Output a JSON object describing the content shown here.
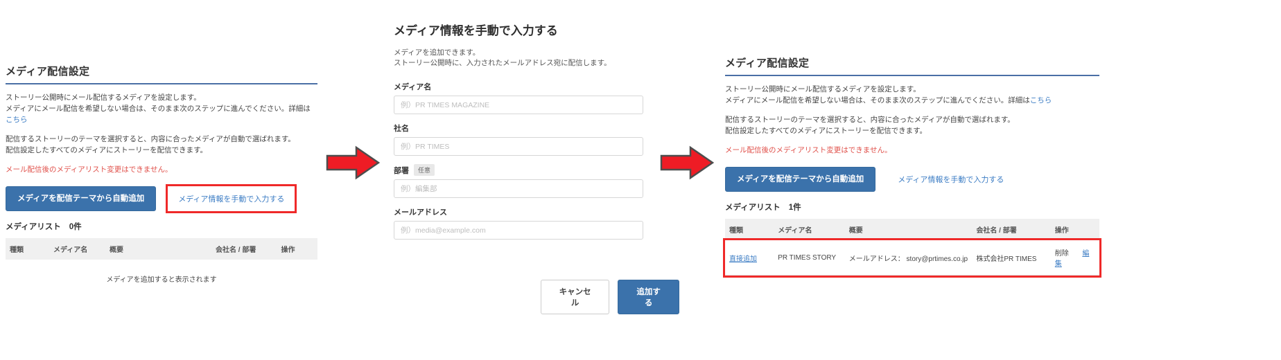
{
  "left_panel": {
    "title": "メディア配信設定",
    "desc_a1": "ストーリー公開時にメール配信するメディアを設定します。",
    "desc_a2_pre": "メディアにメール配信を希望しない場合は、そのまま次のステップに進んでください。詳細は",
    "desc_a2_link": "こちら",
    "desc_b1": "配信するストーリーのテーマを選択すると、内容に合ったメディアが自動で選ばれます。",
    "desc_b2": "配信設定したすべてのメディアにストーリーを配信できます。",
    "warning": "メール配信後のメディアリスト変更はできません。",
    "primary_button": "メディアを配信テーマから自動追加",
    "manual_link": "メディア情報を手動で入力する",
    "list_label": "メディアリスト",
    "list_count": "0件",
    "columns": [
      "種類",
      "メディア名",
      "概要",
      "会社名 / 部署",
      "操作"
    ],
    "empty_message": "メディアを追加すると表示されます"
  },
  "modal": {
    "title": "メディア情報を手動で入力する",
    "desc_line1": "メディアを追加できます。",
    "desc_line2": "ストーリー公開時に、入力されたメールアドレス宛に配信します。",
    "fields": [
      {
        "label": "メディア名",
        "optional": "",
        "placeholder": "例）PR TIMES MAGAZINE",
        "value": ""
      },
      {
        "label": "社名",
        "optional": "",
        "placeholder": "例）PR TIMES",
        "value": ""
      },
      {
        "label": "部署",
        "optional": "任意",
        "placeholder": "例）編集部",
        "value": ""
      },
      {
        "label": "メールアドレス",
        "optional": "",
        "placeholder": "例）media@example.com",
        "value": ""
      }
    ],
    "cancel_label": "キャンセル",
    "submit_label": "追加する"
  },
  "right_panel": {
    "title": "メディア配信設定",
    "desc_a1": "ストーリー公開時にメール配信するメディアを設定します。",
    "desc_a2_pre": "メディアにメール配信を希望しない場合は、そのまま次のステップに進んでください。詳細は",
    "desc_a2_link": "こちら",
    "desc_b1": "配信するストーリーのテーマを選択すると、内容に合ったメディアが自動で選ばれます。",
    "desc_b2": "配信設定したすべてのメディアにストーリーを配信できます。",
    "warning": "メール配信後のメディアリスト変更はできません。",
    "primary_button": "メディアを配信テーマから自動追加",
    "manual_link": "メディア情報を手動で入力する",
    "list_label": "メディアリスト",
    "list_count": "1件",
    "columns": [
      "種類",
      "メディア名",
      "概要",
      "会社名 / 部署",
      "操作"
    ],
    "row": {
      "type": "直接追加",
      "media_name": "PR TIMES STORY",
      "summary": "メールアドレス： story@prtimes.co.jp",
      "company": "株式会社PR TIMES",
      "action_delete": "削除",
      "action_edit": "編集"
    }
  },
  "arrows": {
    "arrow1_name": "right-arrow-icon",
    "arrow2_name": "right-arrow-icon",
    "color": "#ee1c25"
  },
  "colors": {
    "primary": "#3b72ab",
    "link": "#3b7cc4",
    "warning": "#e0504a",
    "highlight": "#ef2929",
    "rule": "#4a6fa5"
  }
}
